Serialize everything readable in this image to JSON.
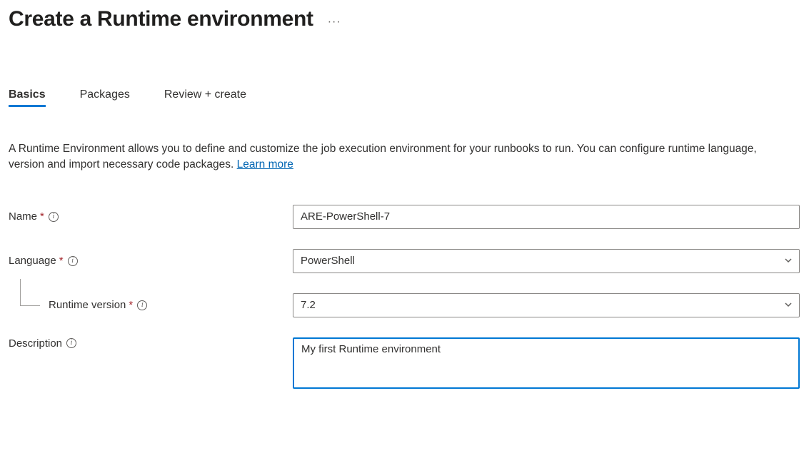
{
  "header": {
    "title": "Create a Runtime environment"
  },
  "tabs": [
    {
      "label": "Basics",
      "active": true
    },
    {
      "label": "Packages",
      "active": false
    },
    {
      "label": "Review + create",
      "active": false
    }
  ],
  "intro": {
    "text": "A Runtime Environment allows you to define and customize the job execution environment for your runbooks to run. You can configure runtime language, version and import necessary code packages. ",
    "link_label": "Learn more"
  },
  "form": {
    "name": {
      "label": "Name",
      "required": true,
      "value": "ARE-PowerShell-7"
    },
    "language": {
      "label": "Language",
      "required": true,
      "value": "PowerShell"
    },
    "runtime_version": {
      "label": "Runtime version",
      "required": true,
      "value": "7.2"
    },
    "description": {
      "label": "Description",
      "required": false,
      "value": "My first Runtime environment"
    }
  }
}
